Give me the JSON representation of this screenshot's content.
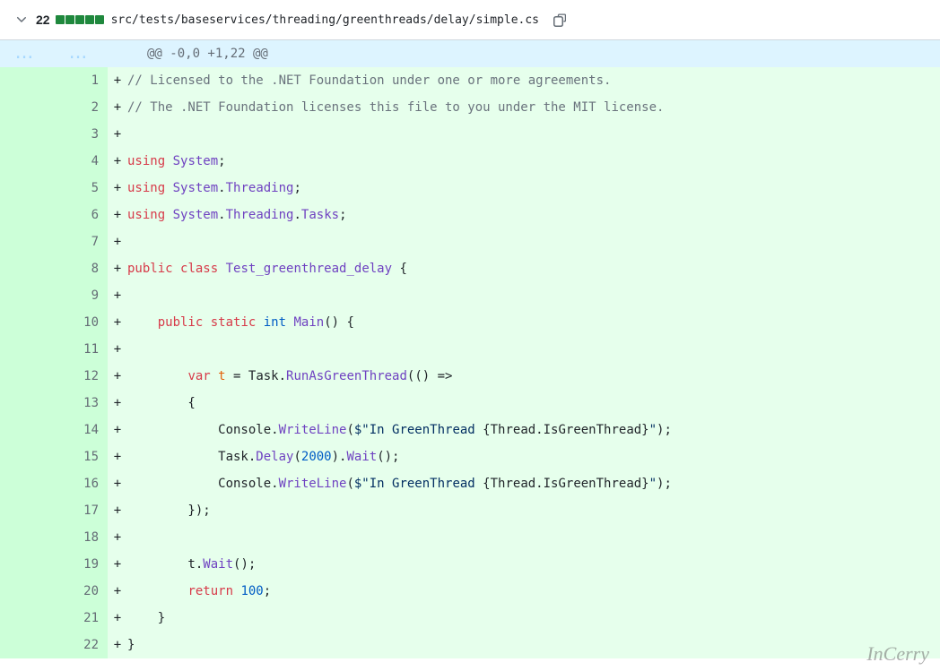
{
  "header": {
    "line_count": "22",
    "file_path": "src/tests/baseservices/threading/greenthreads/delay/simple.cs"
  },
  "hunk": {
    "old_dots": "...",
    "new_dots": "...",
    "header": "@@ -0,0 +1,22 @@"
  },
  "lines": [
    {
      "n": "1",
      "html": "<span class=\"c\">// Licensed to the .NET Foundation under one or more agreements.</span>"
    },
    {
      "n": "2",
      "html": "<span class=\"c\">// The .NET Foundation licenses this file to you under the MIT license.</span>"
    },
    {
      "n": "3",
      "html": ""
    },
    {
      "n": "4",
      "html": "<span class=\"kw\">using</span> <span class=\"tp\">System</span>;"
    },
    {
      "n": "5",
      "html": "<span class=\"kw\">using</span> <span class=\"tp\">System</span>.<span class=\"tp\">Threading</span>;"
    },
    {
      "n": "6",
      "html": "<span class=\"kw\">using</span> <span class=\"tp\">System</span>.<span class=\"tp\">Threading</span>.<span class=\"tp\">Tasks</span>;"
    },
    {
      "n": "7",
      "html": ""
    },
    {
      "n": "8",
      "html": "<span class=\"kw\">public</span> <span class=\"kw\">class</span> <span class=\"tp\">Test_greenthread_delay</span> {"
    },
    {
      "n": "9",
      "html": ""
    },
    {
      "n": "10",
      "html": "    <span class=\"kw\">public</span> <span class=\"kw\">static</span> <span class=\"kb\">int</span> <span class=\"fn\">Main</span>() {"
    },
    {
      "n": "11",
      "html": ""
    },
    {
      "n": "12",
      "html": "        <span class=\"kw\">var</span> <span class=\"vr\">t</span> = Task.<span class=\"fn\">RunAsGreenThread</span>(() =&gt;"
    },
    {
      "n": "13",
      "html": "        {"
    },
    {
      "n": "14",
      "html": "            Console.<span class=\"fn\">WriteLine</span>(<span class=\"str\">$\"In GreenThread </span>{Thread.IsGreenThread}<span class=\"str\">\"</span>);"
    },
    {
      "n": "15",
      "html": "            Task.<span class=\"fn\">Delay</span>(<span class=\"num\">2000</span>).<span class=\"fn\">Wait</span>();"
    },
    {
      "n": "16",
      "html": "            Console.<span class=\"fn\">WriteLine</span>(<span class=\"str\">$\"In GreenThread </span>{Thread.IsGreenThread}<span class=\"str\">\"</span>);"
    },
    {
      "n": "17",
      "html": "        });"
    },
    {
      "n": "18",
      "html": ""
    },
    {
      "n": "19",
      "html": "        t.<span class=\"fn\">Wait</span>();"
    },
    {
      "n": "20",
      "html": "        <span class=\"kw\">return</span> <span class=\"num\">100</span>;"
    },
    {
      "n": "21",
      "html": "    }"
    },
    {
      "n": "22",
      "html": "}"
    }
  ],
  "watermark": "InCerry"
}
